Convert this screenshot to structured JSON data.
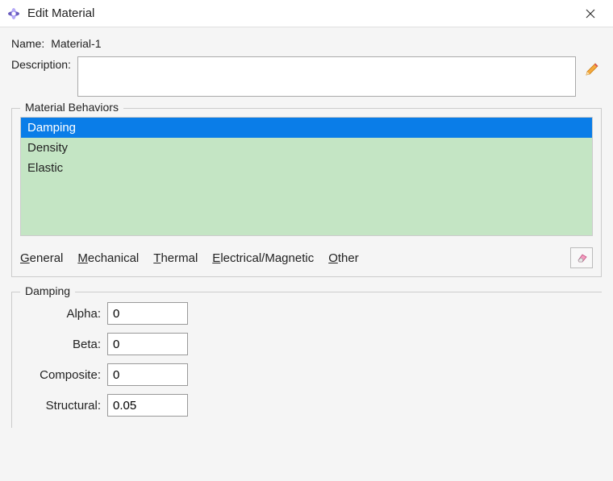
{
  "window": {
    "title": "Edit Material",
    "close_icon": "close"
  },
  "name": {
    "label": "Name:",
    "value": "Material-1"
  },
  "description": {
    "label": "Description:",
    "value": ""
  },
  "behaviors": {
    "legend": "Material Behaviors",
    "items": [
      "Damping",
      "Density",
      "Elastic"
    ],
    "selected_index": 0
  },
  "menu": {
    "general": "General",
    "mechanical": "Mechanical",
    "thermal": "Thermal",
    "electrical": "Electrical/Magnetic",
    "other": "Other"
  },
  "section": {
    "legend": "Damping",
    "params": {
      "alpha": {
        "label": "Alpha:",
        "value": "0"
      },
      "beta": {
        "label": "Beta:",
        "value": "0"
      },
      "composite": {
        "label": "Composite:",
        "value": "0"
      },
      "structural": {
        "label": "Structural:",
        "value": "0.05"
      }
    }
  }
}
